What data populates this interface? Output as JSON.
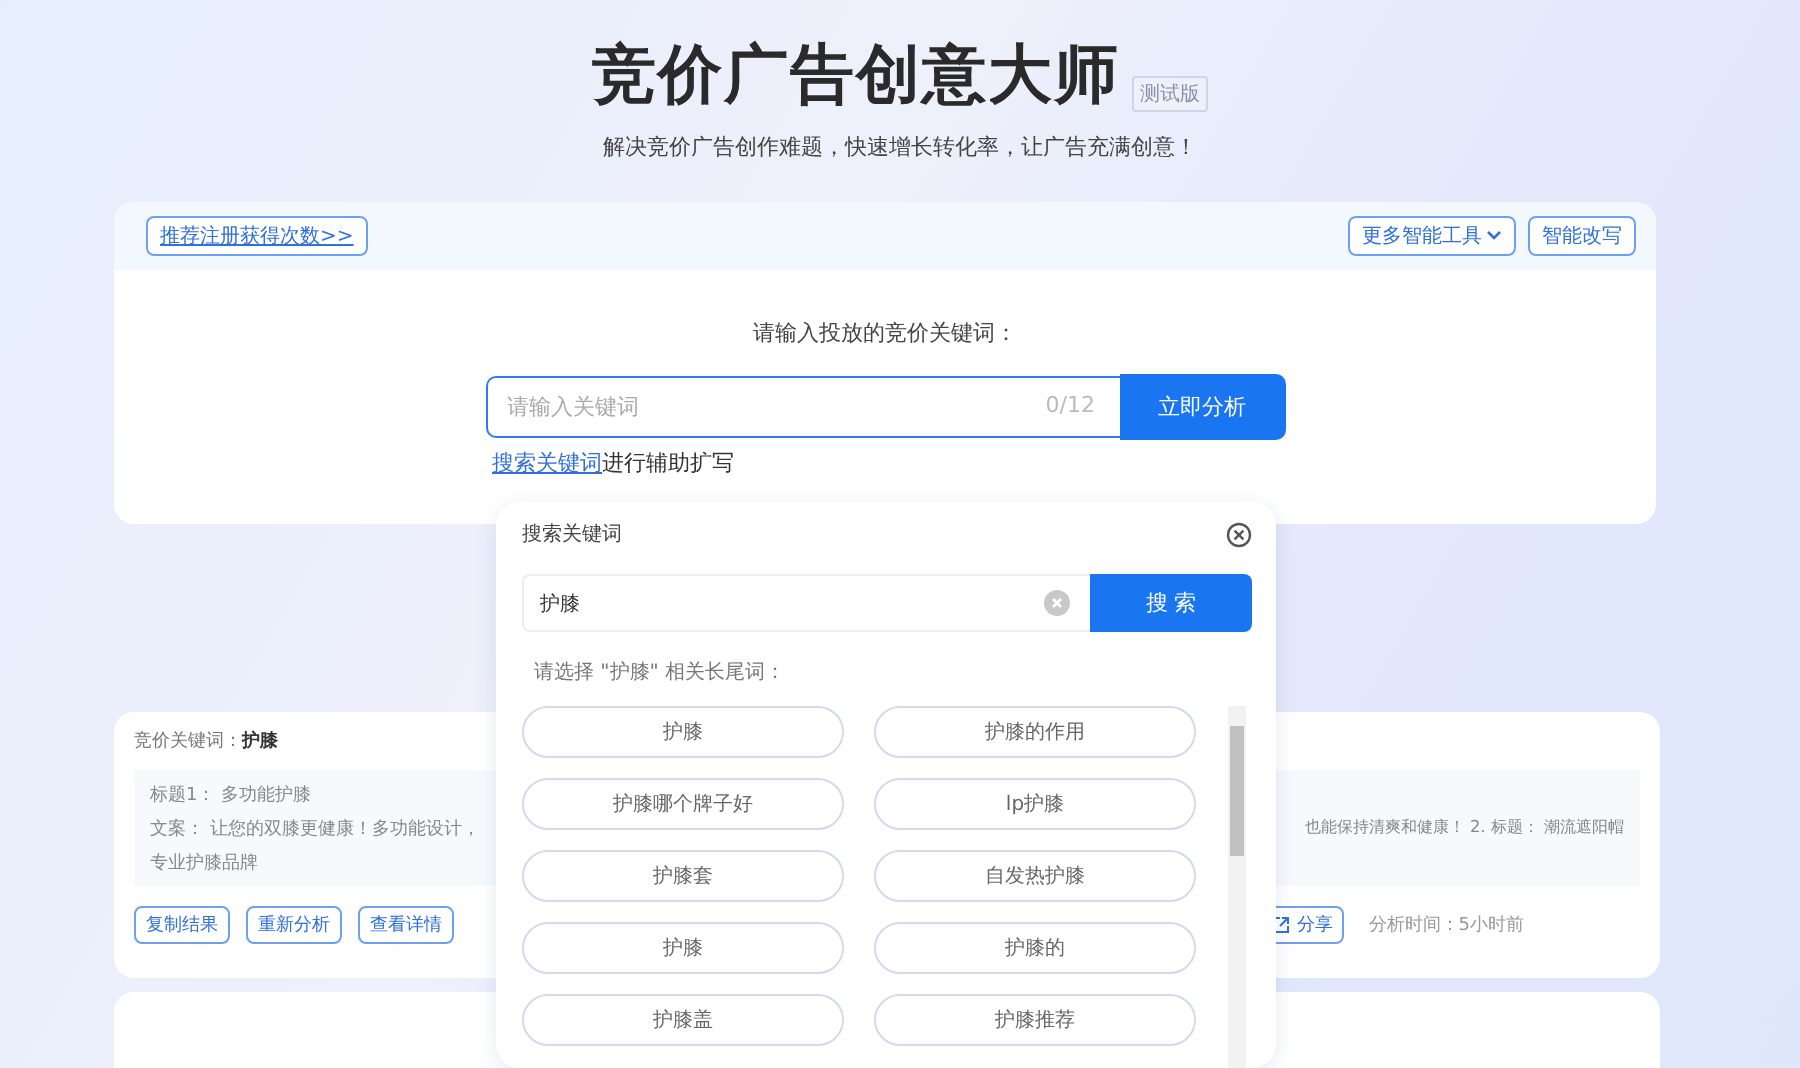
{
  "header": {
    "title": "竞价广告创意大师",
    "badge": "测试版",
    "subtitle": "解决竞价广告创作难题，快速增长转化率，让广告充满创意！"
  },
  "main_card": {
    "promo_link": "推荐注册获得次数>>",
    "tools": [
      {
        "label": "更多智能工具",
        "kind": "dropdown"
      },
      {
        "label": "智能改写",
        "kind": "plain"
      }
    ],
    "prompt": "请输入投放的竞价关键词：",
    "input": {
      "placeholder": "请输入关键词",
      "counter": "0/12"
    },
    "analyze_button": "立即分析",
    "helper_link": "搜索关键词",
    "helper_text": "进行辅助扩写"
  },
  "result_card": {
    "keyword_label": "竞价关键词：",
    "keyword": "护膝",
    "title_line": "标题1： 多功能护膝",
    "copy_left": "文案： 让您的双膝更健康！多功能设计，",
    "copy_right": "也能保持清爽和健康！ 2. 标题： 潮流遮阳帽",
    "copy_line2": "专业护膝品牌",
    "actions": [
      "复制结果",
      "重新分析",
      "查看详情"
    ],
    "share_button": "分享",
    "time": "分析时间：5小时前"
  },
  "popup": {
    "title": "搜索关键词",
    "search_value": "护膝",
    "search_button": "搜 索",
    "hint": "请选择 \"护膝\" 相关长尾词：",
    "keywords": [
      {
        "label": "护膝",
        "selected": false
      },
      {
        "label": "护膝的作用",
        "selected": false
      },
      {
        "label": "护膝哪个牌子好",
        "selected": false
      },
      {
        "label": "lp护膝",
        "selected": false
      },
      {
        "label": "护膝套",
        "selected": false
      },
      {
        "label": "自发热护膝",
        "selected": false
      },
      {
        "label": "护膝",
        "selected": false
      },
      {
        "label": "护膝的",
        "selected": false
      },
      {
        "label": "护膝盖",
        "selected": false
      },
      {
        "label": "护膝推荐",
        "selected": false
      }
    ]
  }
}
